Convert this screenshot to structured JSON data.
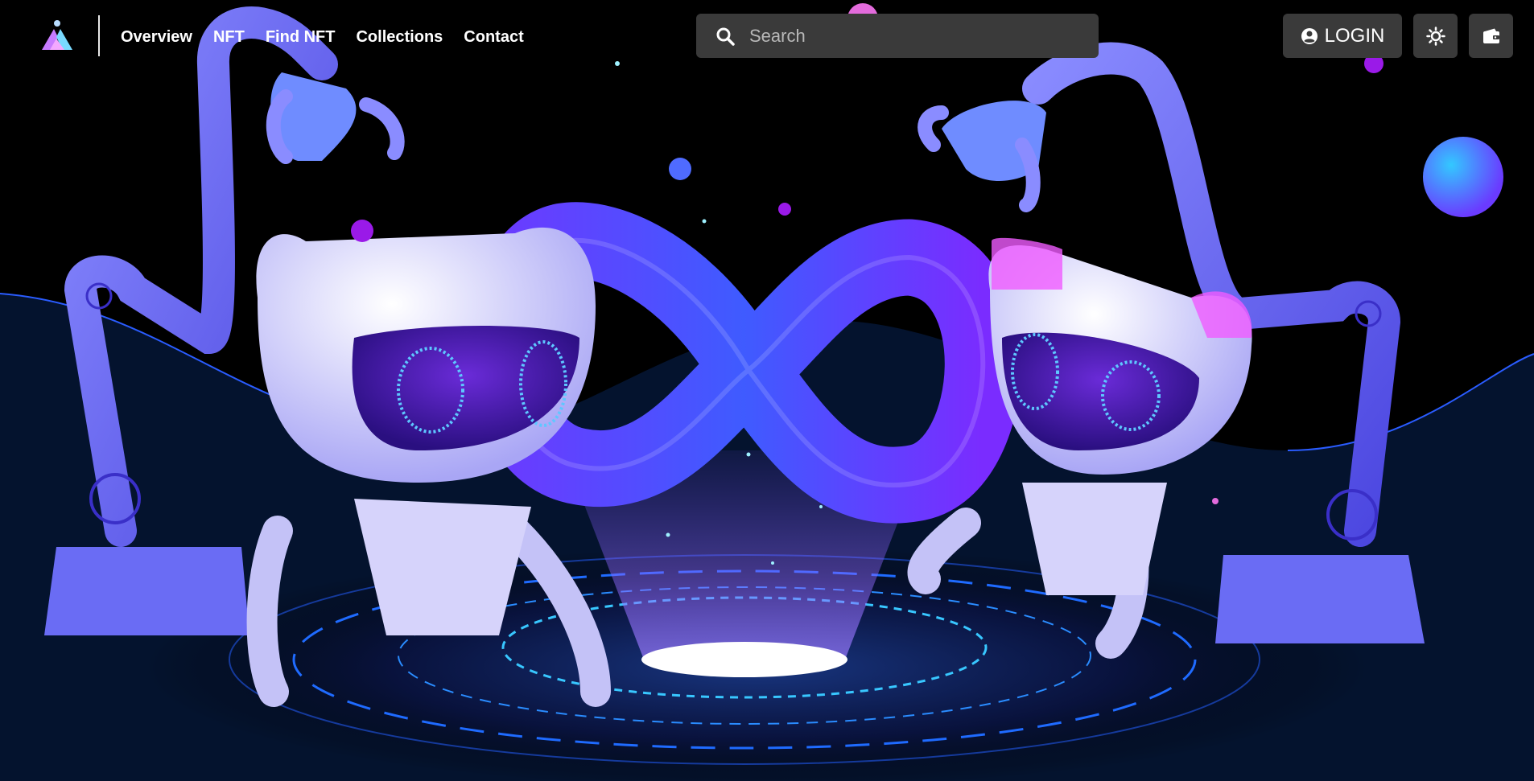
{
  "nav": {
    "logo_icon": "brand-logo",
    "links": [
      "Overview",
      "NFT",
      "Find NFT",
      "Collections",
      "Contact"
    ]
  },
  "search": {
    "placeholder": "Search",
    "icon": "search-icon"
  },
  "login": {
    "label": "LOGIN",
    "icon": "user-circle-icon"
  },
  "theme_toggle": {
    "icon": "sun-icon"
  },
  "wallet": {
    "icon": "wallet-icon"
  },
  "colors": {
    "accent": "#5b3bff",
    "nav_bg": "#3a3a3a",
    "page_bg": "#000000"
  }
}
